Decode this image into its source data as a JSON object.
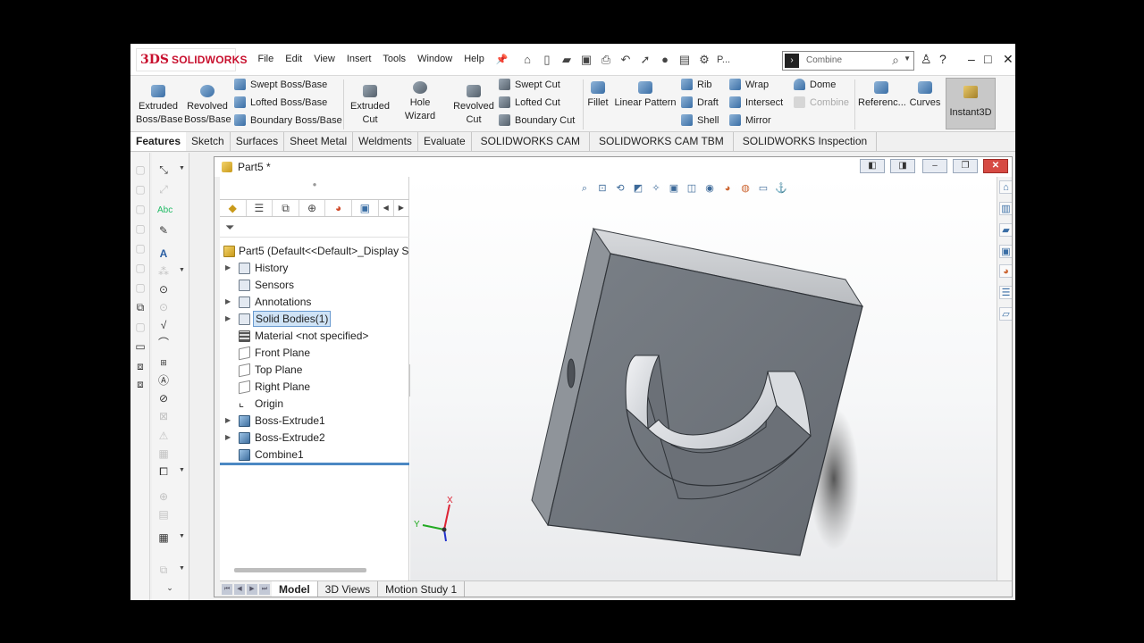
{
  "app": {
    "logo_ds": "3DS",
    "logo_text": "SOLIDWORKS",
    "menu": [
      "File",
      "Edit",
      "View",
      "Insert",
      "Tools",
      "Window",
      "Help"
    ],
    "overflow_label": "P...",
    "search_placeholder": "Combine"
  },
  "ribbon": {
    "extruded_boss": "Extruded\nBoss/Base",
    "revolved_boss": "Revolved\nBoss/Base",
    "swept_boss": "Swept Boss/Base",
    "lofted_boss": "Lofted Boss/Base",
    "boundary_boss": "Boundary Boss/Base",
    "extruded_cut": "Extruded\nCut",
    "hole_wizard": "Hole Wizard",
    "revolved_cut": "Revolved\nCut",
    "swept_cut": "Swept Cut",
    "lofted_cut": "Lofted Cut",
    "boundary_cut": "Boundary Cut",
    "fillet": "Fillet",
    "linear_pattern": "Linear Pattern",
    "rib": "Rib",
    "draft": "Draft",
    "shell": "Shell",
    "wrap": "Wrap",
    "intersect": "Intersect",
    "mirror": "Mirror",
    "dome": "Dome",
    "combine": "Combine",
    "reference": "Referenc...",
    "curves": "Curves",
    "instant3d": "Instant3D"
  },
  "cm_tabs": [
    "Features",
    "Sketch",
    "Surfaces",
    "Sheet Metal",
    "Weldments",
    "Evaluate",
    "SOLIDWORKS CAM",
    "SOLIDWORKS CAM TBM",
    "SOLIDWORKS Inspection"
  ],
  "document": {
    "title": "Part5 *"
  },
  "tree": {
    "root": "Part5  (Default<<Default>_Display S",
    "items": [
      "History",
      "Sensors",
      "Annotations",
      "Solid Bodies(1)",
      "Material <not specified>",
      "Front Plane",
      "Top Plane",
      "Right Plane",
      "Origin",
      "Boss-Extrude1",
      "Boss-Extrude2",
      "Combine1"
    ]
  },
  "bottom_tabs": [
    "Model",
    "3D Views",
    "Motion Study 1"
  ],
  "triad": {
    "x": "X",
    "y": "Y"
  },
  "colors": {
    "body_top": "#6e747b",
    "body_side": "#c9ccd0",
    "accent": "#4b88c3",
    "brand": "#c8102e"
  }
}
